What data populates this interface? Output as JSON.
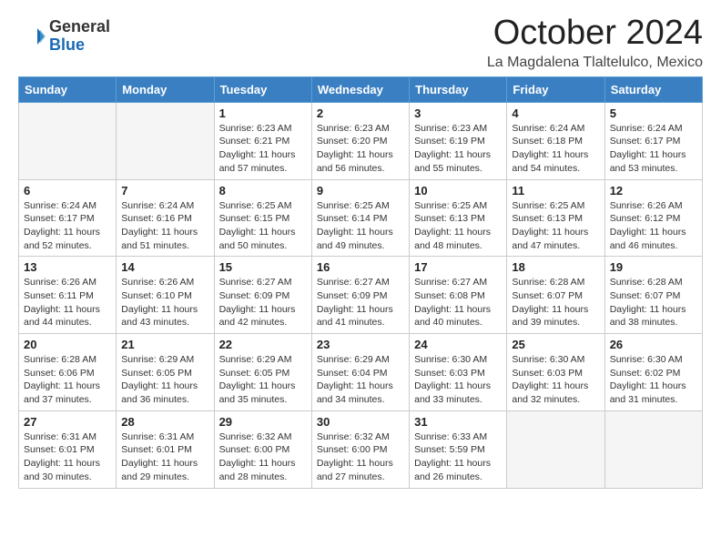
{
  "header": {
    "logo_general": "General",
    "logo_blue": "Blue",
    "month_title": "October 2024",
    "location": "La Magdalena Tlaltelulco, Mexico"
  },
  "days_of_week": [
    "Sunday",
    "Monday",
    "Tuesday",
    "Wednesday",
    "Thursday",
    "Friday",
    "Saturday"
  ],
  "weeks": [
    [
      {
        "day": "",
        "sunrise": "",
        "sunset": "",
        "daylight": ""
      },
      {
        "day": "",
        "sunrise": "",
        "sunset": "",
        "daylight": ""
      },
      {
        "day": "1",
        "sunrise": "Sunrise: 6:23 AM",
        "sunset": "Sunset: 6:21 PM",
        "daylight": "Daylight: 11 hours and 57 minutes."
      },
      {
        "day": "2",
        "sunrise": "Sunrise: 6:23 AM",
        "sunset": "Sunset: 6:20 PM",
        "daylight": "Daylight: 11 hours and 56 minutes."
      },
      {
        "day": "3",
        "sunrise": "Sunrise: 6:23 AM",
        "sunset": "Sunset: 6:19 PM",
        "daylight": "Daylight: 11 hours and 55 minutes."
      },
      {
        "day": "4",
        "sunrise": "Sunrise: 6:24 AM",
        "sunset": "Sunset: 6:18 PM",
        "daylight": "Daylight: 11 hours and 54 minutes."
      },
      {
        "day": "5",
        "sunrise": "Sunrise: 6:24 AM",
        "sunset": "Sunset: 6:17 PM",
        "daylight": "Daylight: 11 hours and 53 minutes."
      }
    ],
    [
      {
        "day": "6",
        "sunrise": "Sunrise: 6:24 AM",
        "sunset": "Sunset: 6:17 PM",
        "daylight": "Daylight: 11 hours and 52 minutes."
      },
      {
        "day": "7",
        "sunrise": "Sunrise: 6:24 AM",
        "sunset": "Sunset: 6:16 PM",
        "daylight": "Daylight: 11 hours and 51 minutes."
      },
      {
        "day": "8",
        "sunrise": "Sunrise: 6:25 AM",
        "sunset": "Sunset: 6:15 PM",
        "daylight": "Daylight: 11 hours and 50 minutes."
      },
      {
        "day": "9",
        "sunrise": "Sunrise: 6:25 AM",
        "sunset": "Sunset: 6:14 PM",
        "daylight": "Daylight: 11 hours and 49 minutes."
      },
      {
        "day": "10",
        "sunrise": "Sunrise: 6:25 AM",
        "sunset": "Sunset: 6:13 PM",
        "daylight": "Daylight: 11 hours and 48 minutes."
      },
      {
        "day": "11",
        "sunrise": "Sunrise: 6:25 AM",
        "sunset": "Sunset: 6:13 PM",
        "daylight": "Daylight: 11 hours and 47 minutes."
      },
      {
        "day": "12",
        "sunrise": "Sunrise: 6:26 AM",
        "sunset": "Sunset: 6:12 PM",
        "daylight": "Daylight: 11 hours and 46 minutes."
      }
    ],
    [
      {
        "day": "13",
        "sunrise": "Sunrise: 6:26 AM",
        "sunset": "Sunset: 6:11 PM",
        "daylight": "Daylight: 11 hours and 44 minutes."
      },
      {
        "day": "14",
        "sunrise": "Sunrise: 6:26 AM",
        "sunset": "Sunset: 6:10 PM",
        "daylight": "Daylight: 11 hours and 43 minutes."
      },
      {
        "day": "15",
        "sunrise": "Sunrise: 6:27 AM",
        "sunset": "Sunset: 6:09 PM",
        "daylight": "Daylight: 11 hours and 42 minutes."
      },
      {
        "day": "16",
        "sunrise": "Sunrise: 6:27 AM",
        "sunset": "Sunset: 6:09 PM",
        "daylight": "Daylight: 11 hours and 41 minutes."
      },
      {
        "day": "17",
        "sunrise": "Sunrise: 6:27 AM",
        "sunset": "Sunset: 6:08 PM",
        "daylight": "Daylight: 11 hours and 40 minutes."
      },
      {
        "day": "18",
        "sunrise": "Sunrise: 6:28 AM",
        "sunset": "Sunset: 6:07 PM",
        "daylight": "Daylight: 11 hours and 39 minutes."
      },
      {
        "day": "19",
        "sunrise": "Sunrise: 6:28 AM",
        "sunset": "Sunset: 6:07 PM",
        "daylight": "Daylight: 11 hours and 38 minutes."
      }
    ],
    [
      {
        "day": "20",
        "sunrise": "Sunrise: 6:28 AM",
        "sunset": "Sunset: 6:06 PM",
        "daylight": "Daylight: 11 hours and 37 minutes."
      },
      {
        "day": "21",
        "sunrise": "Sunrise: 6:29 AM",
        "sunset": "Sunset: 6:05 PM",
        "daylight": "Daylight: 11 hours and 36 minutes."
      },
      {
        "day": "22",
        "sunrise": "Sunrise: 6:29 AM",
        "sunset": "Sunset: 6:05 PM",
        "daylight": "Daylight: 11 hours and 35 minutes."
      },
      {
        "day": "23",
        "sunrise": "Sunrise: 6:29 AM",
        "sunset": "Sunset: 6:04 PM",
        "daylight": "Daylight: 11 hours and 34 minutes."
      },
      {
        "day": "24",
        "sunrise": "Sunrise: 6:30 AM",
        "sunset": "Sunset: 6:03 PM",
        "daylight": "Daylight: 11 hours and 33 minutes."
      },
      {
        "day": "25",
        "sunrise": "Sunrise: 6:30 AM",
        "sunset": "Sunset: 6:03 PM",
        "daylight": "Daylight: 11 hours and 32 minutes."
      },
      {
        "day": "26",
        "sunrise": "Sunrise: 6:30 AM",
        "sunset": "Sunset: 6:02 PM",
        "daylight": "Daylight: 11 hours and 31 minutes."
      }
    ],
    [
      {
        "day": "27",
        "sunrise": "Sunrise: 6:31 AM",
        "sunset": "Sunset: 6:01 PM",
        "daylight": "Daylight: 11 hours and 30 minutes."
      },
      {
        "day": "28",
        "sunrise": "Sunrise: 6:31 AM",
        "sunset": "Sunset: 6:01 PM",
        "daylight": "Daylight: 11 hours and 29 minutes."
      },
      {
        "day": "29",
        "sunrise": "Sunrise: 6:32 AM",
        "sunset": "Sunset: 6:00 PM",
        "daylight": "Daylight: 11 hours and 28 minutes."
      },
      {
        "day": "30",
        "sunrise": "Sunrise: 6:32 AM",
        "sunset": "Sunset: 6:00 PM",
        "daylight": "Daylight: 11 hours and 27 minutes."
      },
      {
        "day": "31",
        "sunrise": "Sunrise: 6:33 AM",
        "sunset": "Sunset: 5:59 PM",
        "daylight": "Daylight: 11 hours and 26 minutes."
      },
      {
        "day": "",
        "sunrise": "",
        "sunset": "",
        "daylight": ""
      },
      {
        "day": "",
        "sunrise": "",
        "sunset": "",
        "daylight": ""
      }
    ]
  ]
}
